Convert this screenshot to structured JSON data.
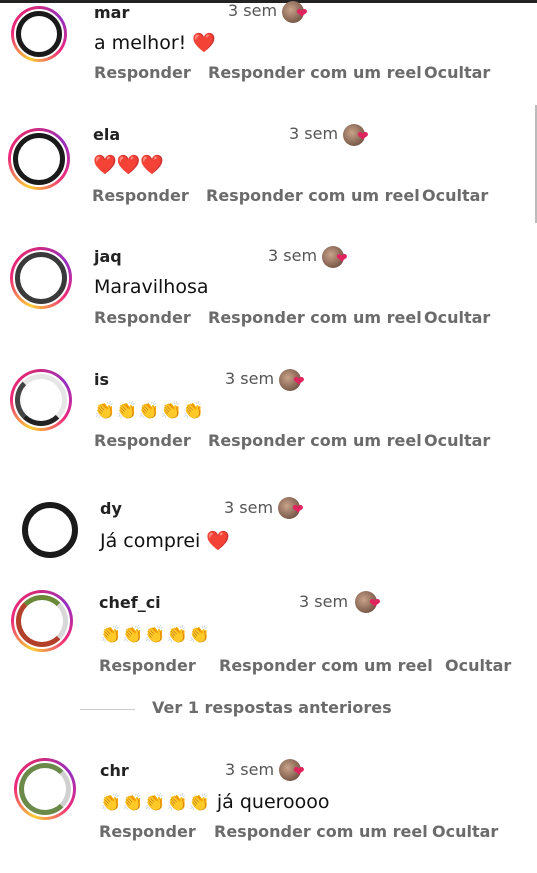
{
  "comments": [
    {
      "username": "mar",
      "time": "3 sem",
      "text": "a melhor!",
      "emoji": "❤️",
      "reply": "Responder",
      "reply_reel": "Responder com um reel",
      "hide": "Ocultar"
    },
    {
      "username": "ela",
      "time": "3 sem",
      "text": "",
      "emoji": "❤️❤️❤️",
      "reply": "Responder",
      "reply_reel": "Responder com um reel",
      "hide": "Ocultar"
    },
    {
      "username": "jaq",
      "time": "3 sem",
      "text": "Maravilhosa",
      "emoji": "",
      "reply": "Responder",
      "reply_reel": "Responder com um reel",
      "hide": "Ocultar"
    },
    {
      "username": "is",
      "time": "3 sem",
      "text": "",
      "emoji": "👏👏👏👏👏",
      "reply": "Responder",
      "reply_reel": "Responder com um reel",
      "hide": "Ocultar"
    },
    {
      "username": "dy",
      "time": "3 sem",
      "text": "Já comprei",
      "emoji": "❤️",
      "reply": "",
      "reply_reel": "",
      "hide": ""
    },
    {
      "username": "chef_ci",
      "time": "3 sem",
      "text": "",
      "emoji": "👏👏👏👏👏",
      "reply": "Responder",
      "reply_reel": "Responder com um reel",
      "hide": "Ocultar"
    },
    {
      "username": "chr",
      "time": "3 sem",
      "text": "já queroooo",
      "emoji": "👏👏👏👏👏",
      "reply": "Responder",
      "reply_reel": "Responder com um reel",
      "hide": "Ocultar"
    }
  ],
  "view_previous": "Ver 1 respostas anteriores",
  "icons": {
    "like": "liked-by-author-icon"
  },
  "colors": {
    "heart": "#e0245e",
    "muted": "#6b6b6b"
  }
}
